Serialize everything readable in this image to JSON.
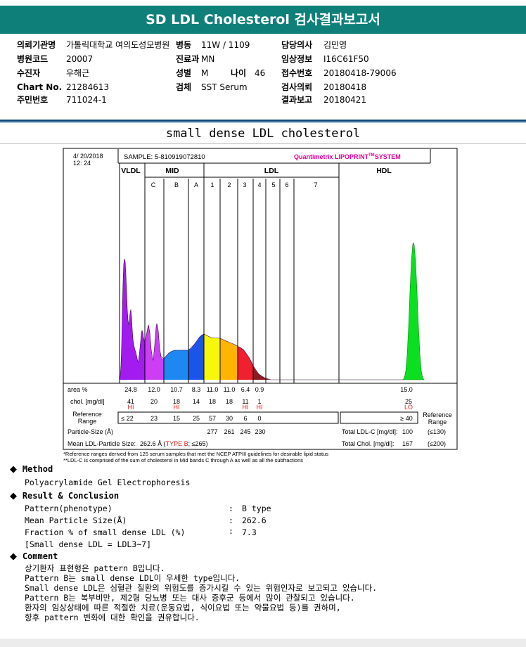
{
  "header": {
    "title": "SD LDL Cholesterol 검사결과보고서"
  },
  "info": {
    "institution_label": "의뢰기관명",
    "institution": "가톨릭대학교 여의도성모병원",
    "ward_label": "병동",
    "ward": "11W / 1109",
    "doctor_label": "담당의사",
    "doctor": "김민영",
    "hospital_code_label": "병원코드",
    "hospital_code": "20007",
    "dept_label": "진료과",
    "dept": "MN",
    "clinical_info_label": "임상정보",
    "clinical_info": "I16C61F50",
    "patient_label": "수진자",
    "patient": "우해근",
    "sex_label": "성별",
    "sex": "M",
    "age_label": "나이",
    "age": "46",
    "receipt_label": "접수번호",
    "receipt": "20180418-79006",
    "chart_label": "Chart No.",
    "chart": "21284613",
    "specimen_label": "검체",
    "specimen": "SST Serum",
    "request_date_label": "검사의뢰",
    "request_date": "20180418",
    "id_label": "주민번호",
    "id": "711024-1",
    "report_date_label": "결과보고",
    "report_date": "20180421"
  },
  "subtitle": "small dense LDL cholesterol",
  "lipoprint": {
    "date": "4/ 20/2018",
    "time": "12: 24",
    "sample": "SAMPLE:  5-810919072810",
    "system": "Quantimetrix LIPOPRINT",
    "system_tm": "TM",
    "system_suffix": "SYSTEM",
    "groups": [
      "VLDL",
      "MID",
      "LDL",
      "HDL"
    ],
    "bands": [
      "C",
      "B",
      "A",
      "1",
      "2",
      "3",
      "4",
      "5",
      "6",
      "7"
    ],
    "rows": {
      "area_label": "area %",
      "area": [
        "24.8",
        "12.0",
        "10.7",
        "8.3",
        "11.0",
        "11.0",
        "6.4",
        "0.9",
        "15.0"
      ],
      "chol_label": "chol. [mg/dl]",
      "chol": [
        "41",
        "20",
        "18",
        "14",
        "18",
        "18",
        "11",
        "1",
        "25"
      ],
      "flags": [
        "HI",
        "HI",
        "HI",
        "HI",
        "LO"
      ],
      "ref_label_1": "Reference",
      "ref_label_2": "Range",
      "ref": [
        "≤ 22",
        "23",
        "15",
        "25",
        "57",
        "30",
        "6",
        "0",
        "≥ 40"
      ],
      "ref_right_1": "Reference",
      "ref_right_2": "Range",
      "ps_label": "Particle-Size (Å)",
      "ps": [
        "277",
        "261",
        "245",
        "230"
      ],
      "mean_label": "Mean LDL-Particle Size:",
      "mean_value": "262.6 Å (",
      "mean_type": "TYPE B",
      "mean_suffix": "; ≤265)",
      "total_ldl_label": "Total LDL-C [mg/dl]:",
      "total_ldl": "100",
      "total_ldl_ref": "(≤130)",
      "total_chol_label": "Total Chol. [mg/dl]:",
      "total_chol": "167",
      "total_chol_ref": "(≤200)"
    },
    "note1": "*Reference ranges derived from 125 serum samples that met the NCEP ATPIII guidelines for desirable lipid status",
    "note2": "**LDL-C is comprised of the sum of cholesterol in Mid bands C through A as well as all the subfractions"
  },
  "method": {
    "heading": "Method",
    "text": "Polyacrylamide Gel Electrophoresis"
  },
  "result": {
    "heading": "Result & Conclusion",
    "items": [
      {
        "label": "Pattern(phenotype)",
        "value": "B type"
      },
      {
        "label": "Mean Particle Size(Å)",
        "value": "262.6"
      },
      {
        "label": "Fraction % of small dense LDL (%)",
        "value": "7.3"
      }
    ],
    "colon": ":",
    "note": "[Small dense LDL = LDL3~7]"
  },
  "comment": {
    "heading": "Comment",
    "lines": [
      "상기환자 표현형은 pattern B입니다.",
      "Pattern B는 small dense LDL이 우세한 type입니다.",
      "Small dense LDL은 심혈관 질환의 위험도를 증가시킬 수 있는 위험인자로 보고되고 있습니다.",
      "Pattern B는 복부비만, 제2형 당뇨병 또는 대사 증후군 등에서 많이 관찰되고 있습니다.",
      "환자의 임상상태에 따른 적절한 치료(운동요법, 식이요법 또는 약물요법 등)를 권하며,",
      "향후 pattern 변화에 대한 확인을 권유합니다."
    ]
  },
  "colors": {
    "banner": "#0e8079",
    "vldl": "#a21cf0",
    "mid_c": "#cc3df4",
    "mid_b": "#1e88f2",
    "mid_a": "#1b55e8",
    "ldl1": "#f7f70c",
    "ldl2": "#ffb400",
    "ldl3": "#f02030",
    "hdl": "#0ae020",
    "system": "#e0009a",
    "flag": "#e02020"
  }
}
